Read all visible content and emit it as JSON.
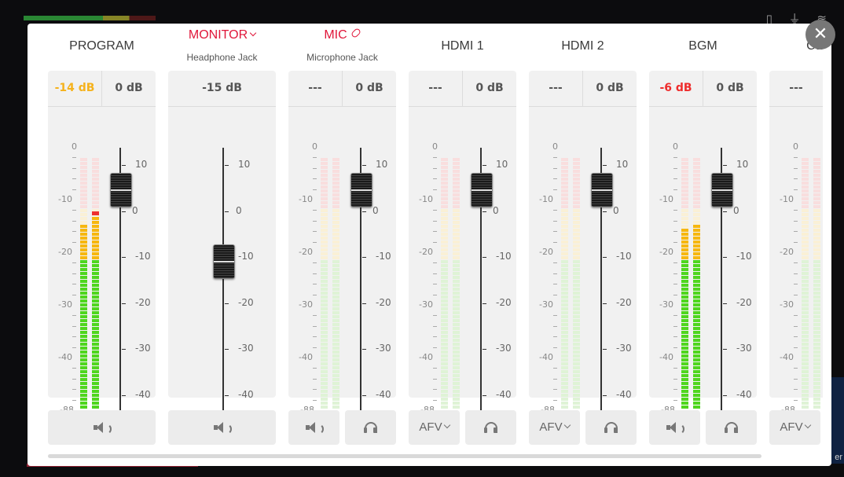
{
  "background": {
    "status_icons": "▯ ⏚ ≋",
    "right_text": "er"
  },
  "close_label": "✕",
  "meter_scale": [
    "0",
    "-10",
    "-20",
    "-30",
    "-40",
    "-88"
  ],
  "fader_scale": [
    "10",
    "0",
    "-10",
    "-20",
    "-30",
    "-40"
  ],
  "channels": [
    {
      "name": "PROGRAM",
      "sub": "",
      "db_left": "-14 dB",
      "db_right": "0 dB",
      "level_l": 0.72,
      "level_r": 0.76,
      "peak_r": true,
      "fader": 0.84,
      "buttons": [
        "speaker"
      ]
    },
    {
      "name": "MONITOR",
      "sub": "Headphone Jack",
      "db_single": "-15 dB",
      "fader": 0.57,
      "buttons": [
        "speaker"
      ]
    },
    {
      "name": "MIC",
      "sub": "Microphone Jack",
      "db_left": "---",
      "db_right": "0 dB",
      "level_l": 0,
      "level_r": 0,
      "fader": 0.84,
      "buttons": [
        "speaker",
        "headphone"
      ]
    },
    {
      "name": "HDMI 1",
      "sub": "",
      "db_left": "---",
      "db_right": "0 dB",
      "level_l": 0,
      "level_r": 0,
      "fader": 0.84,
      "buttons": [
        "afv",
        "headphone"
      ]
    },
    {
      "name": "HDMI 2",
      "sub": "",
      "db_left": "---",
      "db_right": "0 dB",
      "level_l": 0,
      "level_r": 0,
      "fader": 0.84,
      "buttons": [
        "afv",
        "headphone"
      ]
    },
    {
      "name": "BGM",
      "sub": "",
      "db_left": "-6 dB",
      "db_right": "0 dB",
      "level_l": 0.71,
      "level_r": 0.73,
      "fader": 0.84,
      "buttons": [
        "speaker",
        "headphone"
      ]
    },
    {
      "name": "Came",
      "sub": "",
      "db_left": "---",
      "db_right": "",
      "level_l": 0,
      "level_r": 0,
      "fader": 0.84,
      "buttons": [
        "afv"
      ]
    }
  ],
  "afv_label": "AFV"
}
